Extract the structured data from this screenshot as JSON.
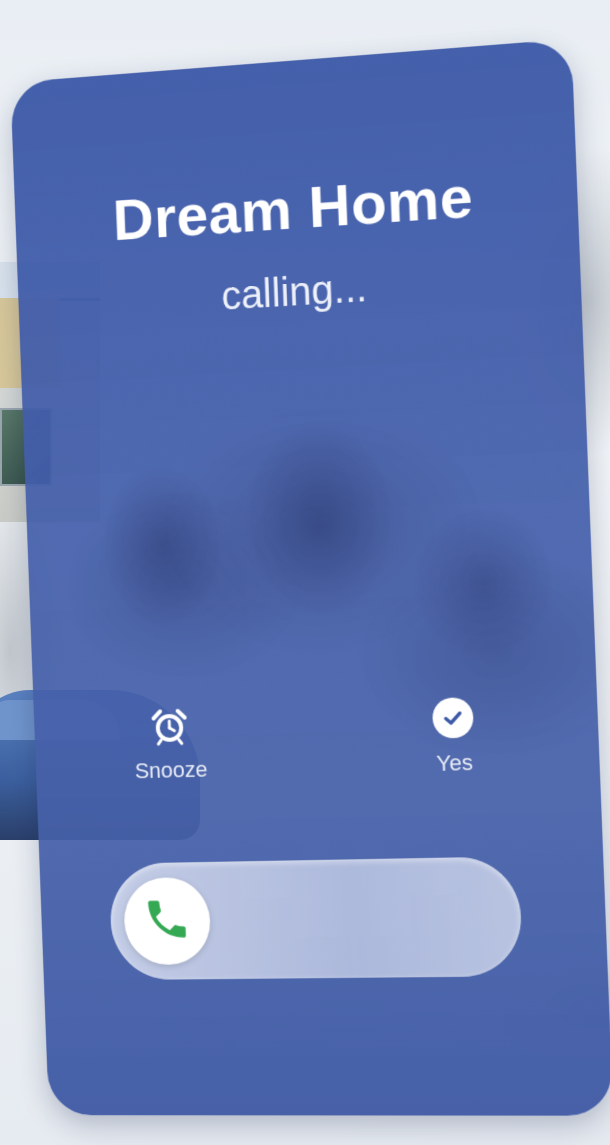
{
  "call": {
    "caller_name": "Dream Home",
    "status_text": "calling..."
  },
  "actions": {
    "snooze_label": "Snooze",
    "snooze_icon": "alarm-clock-icon",
    "yes_label": "Yes",
    "yes_icon": "check-circle-icon"
  },
  "slider": {
    "handle_icon": "phone-icon",
    "handle_color": "#34a853"
  },
  "colors": {
    "card": "#3d59a8",
    "text": "#ffffff"
  }
}
